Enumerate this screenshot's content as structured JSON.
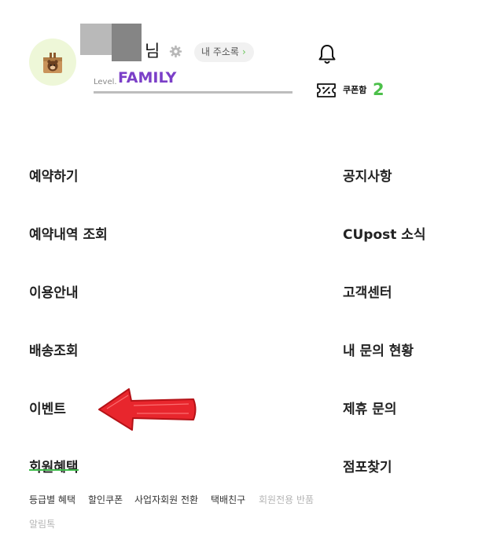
{
  "profile": {
    "name_suffix": "님",
    "address_book_label": "내 주소록",
    "address_book_chevron": "›",
    "level_label": "Level.",
    "level_value": "FAMILY"
  },
  "header": {
    "bell_icon": "bell-icon",
    "coupon_icon": "coupon-icon",
    "coupon_label": "쿠폰함",
    "coupon_count": "2"
  },
  "menu_left": [
    "예약하기",
    "예약내역 조회",
    "이용안내",
    "배송조회",
    "이벤트",
    "회원혜택"
  ],
  "menu_right": [
    "공지사항",
    "CUpost 소식",
    "고객센터",
    "내 문의 현황",
    "제휴 문의",
    "점포찾기"
  ],
  "benefit_links": [
    "등급별 혜택",
    "할인쿠폰",
    "사업자회원 전환",
    "택배친구",
    "회원전용 반품",
    "알림톡"
  ],
  "colors": {
    "level": "#7b3fc8",
    "coupon_count": "#4cc04a",
    "arrow": "#e8262d",
    "strike": "#3dbb4a",
    "avatar_bg": "#eef7d8"
  }
}
